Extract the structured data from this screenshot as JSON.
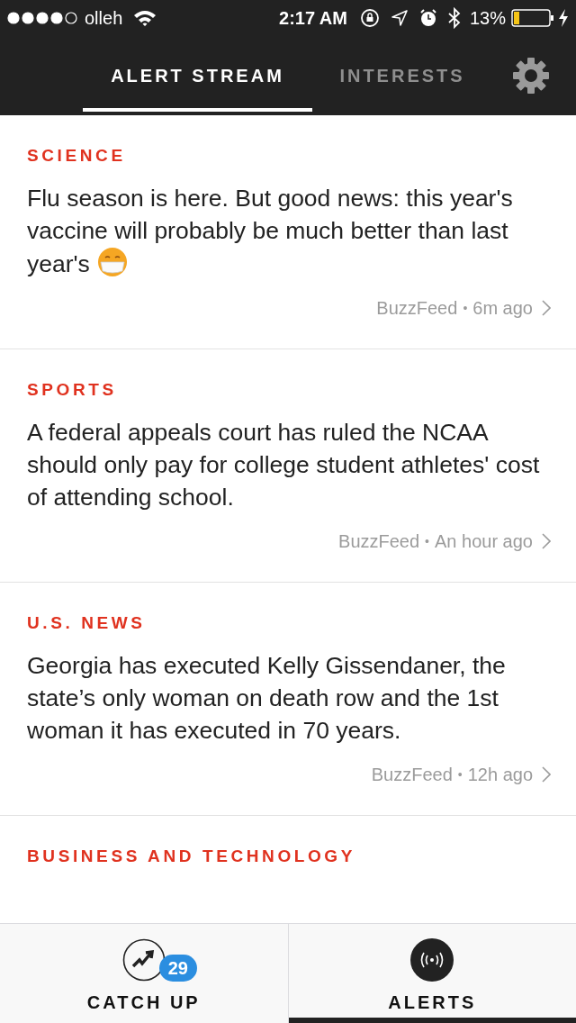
{
  "status_bar": {
    "carrier": "olleh",
    "time": "2:17 AM",
    "battery": "13%"
  },
  "tabs": [
    {
      "label": "ALERT STREAM",
      "selected": true
    },
    {
      "label": "INTERESTS",
      "selected": false
    }
  ],
  "alerts": [
    {
      "category": "SCIENCE",
      "headline": "Flu season is here. But good news: this year's vaccine will probably be much better than last year's",
      "emoji": true,
      "source": "BuzzFeed",
      "separator": "•",
      "time": "6m ago"
    },
    {
      "category": "SPORTS",
      "headline": "A federal appeals court has ruled the NCAA should only pay for college student athletes' cost of attending school.",
      "emoji": false,
      "source": "BuzzFeed",
      "separator": "•",
      "time": "An hour ago"
    },
    {
      "category": "U.S. NEWS",
      "headline": "Georgia has executed Kelly Gissendaner, the state’s only woman on death row and the 1st woman it has executed in 70 years.",
      "emoji": false,
      "source": "BuzzFeed",
      "separator": "•",
      "time": "12h ago"
    },
    {
      "category": "BUSINESS AND TECHNOLOGY"
    }
  ],
  "bottom_tabs": [
    {
      "kind": "catchup",
      "label": "CATCH UP",
      "badge": "29",
      "selected": false
    },
    {
      "kind": "alerts",
      "label": "ALERTS",
      "selected": true
    }
  ]
}
